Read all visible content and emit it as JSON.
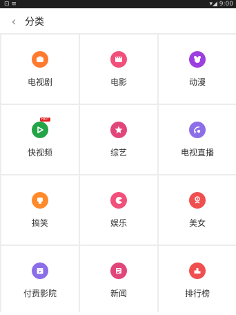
{
  "status_bar": {
    "left": "⊡ ≡",
    "right": "▾◢ 9:00"
  },
  "header": {
    "back_label": "‹",
    "title": "分类"
  },
  "categories": [
    {
      "label": "电视剧",
      "color": "#ff7a2f",
      "icon": "tv-icon"
    },
    {
      "label": "电影",
      "color": "#f0507a",
      "icon": "film-icon"
    },
    {
      "label": "动漫",
      "color": "#9c3fe0",
      "icon": "anime-icon"
    },
    {
      "label": "快视频",
      "color": "#22a447",
      "icon": "play-icon",
      "badge": "HOT"
    },
    {
      "label": "综艺",
      "color": "#e0467a",
      "icon": "star-icon"
    },
    {
      "label": "电视直播",
      "color": "#8b6ee8",
      "icon": "satellite-icon"
    },
    {
      "label": "搞笑",
      "color": "#ff8a2a",
      "icon": "laugh-icon"
    },
    {
      "label": "娱乐",
      "color": "#f0507a",
      "icon": "pacman-icon"
    },
    {
      "label": "美女",
      "color": "#f04f4f",
      "icon": "flower-icon"
    },
    {
      "label": "付费影院",
      "color": "#8b6ee8",
      "icon": "clapper-icon"
    },
    {
      "label": "新闻",
      "color": "#e0467a",
      "icon": "news-icon"
    },
    {
      "label": "排行榜",
      "color": "#f04f4f",
      "icon": "rank-icon"
    }
  ]
}
